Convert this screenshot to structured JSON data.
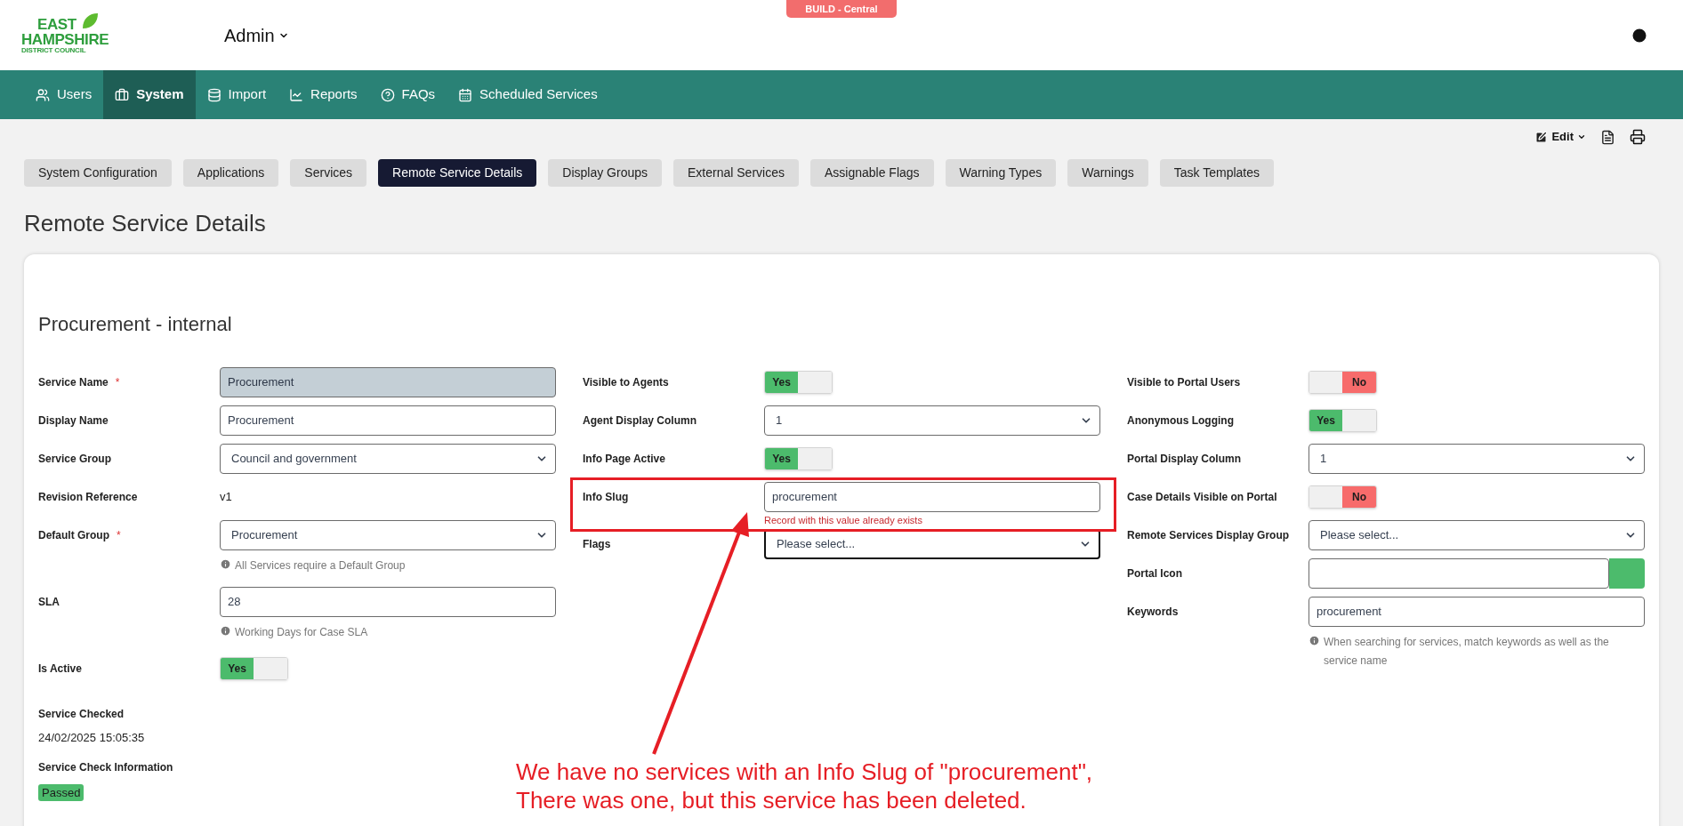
{
  "build_badge": "BUILD - Central",
  "logo": {
    "lines": [
      "EAST",
      "HAMPSHIRE",
      "DISTRICT COUNCIL"
    ]
  },
  "header": {
    "menu": "Admin"
  },
  "nav": [
    {
      "label": "Users",
      "selected": false
    },
    {
      "label": "System",
      "selected": true
    },
    {
      "label": "Import",
      "selected": false
    },
    {
      "label": "Reports",
      "selected": false
    },
    {
      "label": "FAQs",
      "selected": false
    },
    {
      "label": "Scheduled Services",
      "selected": false
    }
  ],
  "toolbar": {
    "edit": "Edit"
  },
  "tabs": [
    {
      "label": "System Configuration",
      "selected": false
    },
    {
      "label": "Applications",
      "selected": false
    },
    {
      "label": "Services",
      "selected": false
    },
    {
      "label": "Remote Service Details",
      "selected": true
    },
    {
      "label": "Display Groups",
      "selected": false
    },
    {
      "label": "External Services",
      "selected": false
    },
    {
      "label": "Assignable Flags",
      "selected": false
    },
    {
      "label": "Warning Types",
      "selected": false
    },
    {
      "label": "Warnings",
      "selected": false
    },
    {
      "label": "Task Templates",
      "selected": false
    }
  ],
  "page_title": "Remote Service Details",
  "record": {
    "title": "Procurement - internal",
    "columns": [
      [
        {
          "label": "Service Name",
          "required_mark": "*",
          "kind": "readonly",
          "value": "Procurement"
        },
        {
          "label": "Display Name",
          "kind": "text",
          "value": "Procurement"
        },
        {
          "label": "Service Group",
          "kind": "select",
          "value": "Council and government",
          "focused": false
        },
        {
          "label": "Revision Reference",
          "kind": "static",
          "value": "v1"
        },
        {
          "label": "Default Group",
          "required_mark": "*",
          "kind": "select",
          "value": "Procurement",
          "focused": false,
          "hint": "All Services require a Default Group"
        },
        {
          "label": "SLA",
          "kind": "text",
          "value": "28",
          "hint": "Working Days for Case SLA"
        },
        {
          "label": "Is Active",
          "kind": "toggle",
          "on": true,
          "text": "Yes"
        }
      ],
      [
        {
          "label": "Visible to Agents",
          "kind": "toggle",
          "on": true,
          "text": "Yes"
        },
        {
          "label": "Agent Display Column",
          "kind": "select",
          "value": "1",
          "focused": false
        },
        {
          "label": "Info Page Active",
          "kind": "toggle",
          "on": true,
          "text": "Yes"
        },
        {
          "label": "Info Slug",
          "kind": "text",
          "value": "procurement",
          "error": "Record with this value already exists"
        },
        {
          "label": "Flags",
          "kind": "select",
          "value": "Please select...",
          "focused": true
        }
      ],
      [
        {
          "label": "Visible to Portal Users",
          "kind": "toggle",
          "on": false,
          "text": "No"
        },
        {
          "label": "Anonymous Logging",
          "kind": "toggle",
          "on": true,
          "text": "Yes"
        },
        {
          "label": "Portal Display Column",
          "kind": "select",
          "value": "1",
          "focused": false
        },
        {
          "label": "Case Details Visible on Portal",
          "kind": "toggle",
          "on": false,
          "text": "No"
        },
        {
          "label": "Remote Services Display Group",
          "kind": "select",
          "value": "Please select...",
          "focused": false
        },
        {
          "label": "Portal Icon",
          "kind": "icon_picker"
        },
        {
          "label": "Keywords",
          "kind": "text",
          "value": "procurement",
          "hint": "When searching for services, match keywords as well as the service name"
        }
      ]
    ],
    "service_checked": {
      "label": "Service Checked",
      "value": "24/02/2025 15:05:35"
    },
    "service_check_information": {
      "label": "Service Check Information",
      "status": "Passed"
    }
  },
  "annotation": {
    "lines": [
      "We have no services with an Info Slug of \"procurement\",",
      "There was one, but this service has been deleted."
    ]
  }
}
